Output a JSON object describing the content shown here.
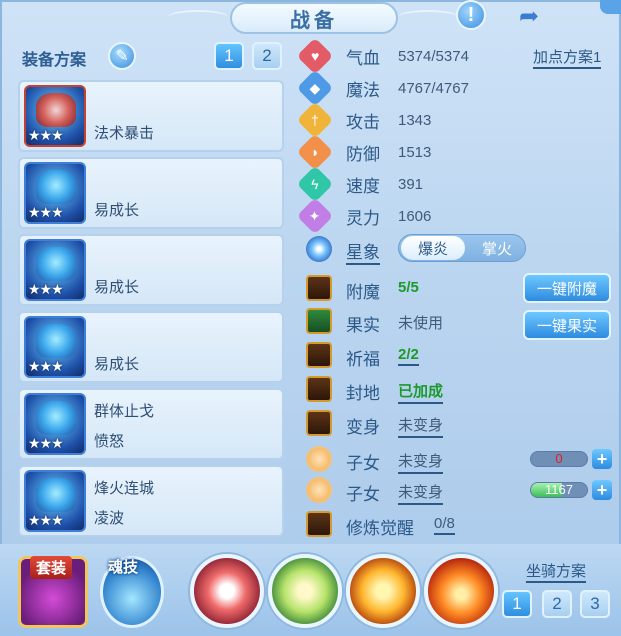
{
  "header": {
    "title": "战备"
  },
  "left": {
    "scheme_label": "装备方案",
    "scheme_buttons": [
      "1",
      "2"
    ],
    "slots": [
      {
        "line1": "法术暴击",
        "line2": "",
        "stars": "★★★"
      },
      {
        "line1": "易成长",
        "line2": "",
        "stars": "★★★"
      },
      {
        "line1": "易成长",
        "line2": "",
        "stars": "★★★"
      },
      {
        "line1": "易成长",
        "line2": "",
        "stars": "★★★"
      },
      {
        "line1": "群体止戈",
        "line2": "愤怒",
        "stars": "★★★"
      },
      {
        "line1": "烽火连城",
        "line2": "凌波",
        "stars": "★★★"
      }
    ]
  },
  "stats": {
    "addpoint_label": "加点方案1",
    "rows": [
      {
        "name": "气血",
        "value": "5374/5374",
        "icon": "heart-icon",
        "color": "#e35b67"
      },
      {
        "name": "魔法",
        "value": "4767/4767",
        "icon": "magic-icon",
        "color": "#4f9ae6"
      },
      {
        "name": "攻击",
        "value": "1343",
        "icon": "sword-icon",
        "color": "#f0b43a"
      },
      {
        "name": "防御",
        "value": "1513",
        "icon": "shield-icon",
        "color": "#f2904a"
      },
      {
        "name": "速度",
        "value": "391",
        "icon": "speed-icon",
        "color": "#2fc7a7"
      },
      {
        "name": "灵力",
        "value": "1606",
        "icon": "spirit-icon",
        "color": "#c07ee6"
      }
    ]
  },
  "star": {
    "label": "星象",
    "toggle_on": "爆炎",
    "toggle_off": "掌火"
  },
  "features": {
    "rows": [
      {
        "name": "附魔",
        "value": "5/5",
        "style": "green"
      },
      {
        "name": "果实",
        "value": "未使用",
        "style": "plain"
      },
      {
        "name": "祈福",
        "value": "2/2",
        "style": "green-ul"
      },
      {
        "name": "封地",
        "value": "已加成",
        "style": "green-ul"
      },
      {
        "name": "变身",
        "value": "未变身",
        "style": "ul"
      },
      {
        "name": "子女",
        "value": "未变身",
        "style": "ul"
      },
      {
        "name": "子女",
        "value": "未变身",
        "style": "ul"
      },
      {
        "name": "修炼觉醒",
        "value": "0/8",
        "style": "ul"
      }
    ],
    "enchant_button": "一键附魔",
    "fruit_button": "一键果实",
    "child1_bar": {
      "text": "0",
      "progress": 0
    },
    "child2_bar": {
      "text": "1167",
      "progress": 0.55
    }
  },
  "bottom": {
    "suit_label": "套装",
    "soul_label": "魂技",
    "mount_label": "坐骑方案",
    "mount_buttons": [
      "1",
      "2",
      "3"
    ]
  }
}
